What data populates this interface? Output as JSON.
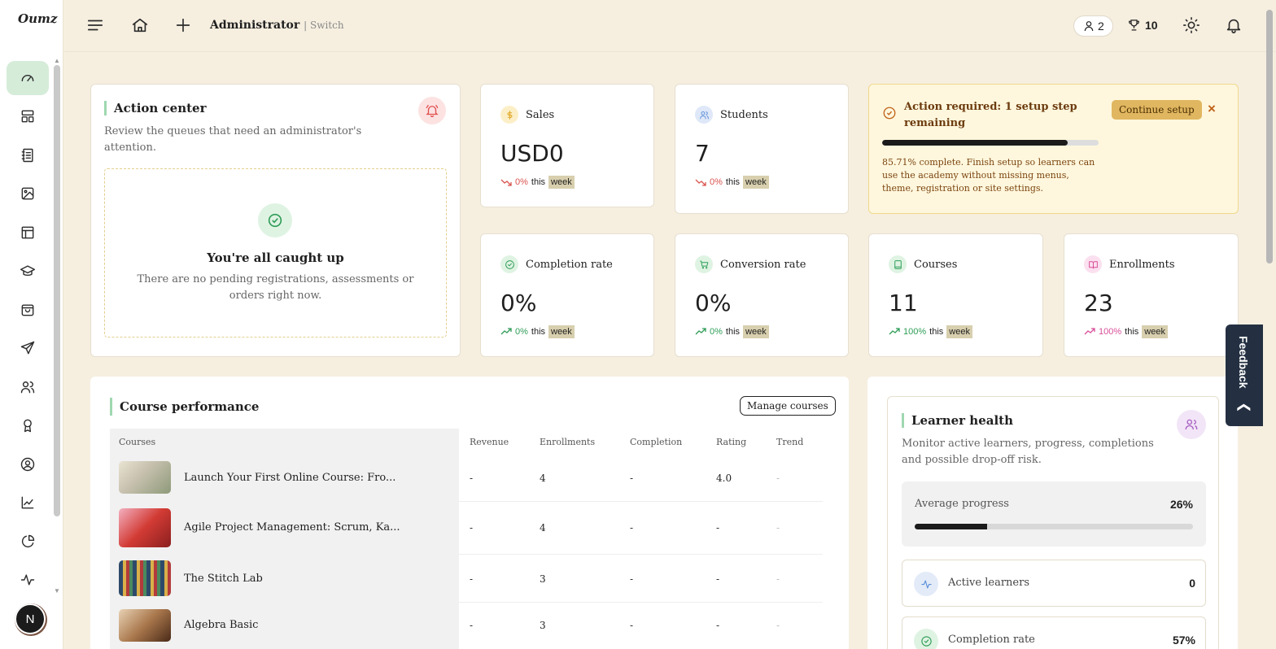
{
  "app": {
    "logo": "Oumz"
  },
  "topbar": {
    "title": "Administrator",
    "switch_label": "| Switch",
    "users_count": "2",
    "trophy_count": "10"
  },
  "sidebar": {
    "items": [
      {
        "icon": "dashboard-icon",
        "active": true
      },
      {
        "icon": "layout-icon"
      },
      {
        "icon": "notebook-icon"
      },
      {
        "icon": "image-icon"
      },
      {
        "icon": "template-icon"
      },
      {
        "icon": "graduation-cap-icon"
      },
      {
        "icon": "shopping-bag-icon"
      },
      {
        "icon": "send-icon"
      },
      {
        "icon": "users-icon"
      },
      {
        "icon": "award-icon"
      },
      {
        "icon": "user-circle-icon"
      },
      {
        "icon": "line-chart-icon"
      },
      {
        "icon": "pie-chart-icon"
      },
      {
        "icon": "activity-icon"
      }
    ],
    "avatar_letter": "N"
  },
  "action_center": {
    "title": "Action center",
    "description": "Review the queues that need an administrator's attention.",
    "empty_title": "You're all caught up",
    "empty_text": "There are no pending registrations, assessments or orders right now."
  },
  "stats": {
    "sales": {
      "label": "Sales",
      "value": "USD0",
      "trend": "0%",
      "this": "this",
      "week": "week",
      "direction": "down",
      "color": "#e0a31f"
    },
    "students": {
      "label": "Students",
      "value": "7",
      "trend": "0%",
      "this": "this",
      "week": "week",
      "direction": "down",
      "color": "#5b8fd8"
    },
    "completion": {
      "label": "Completion rate",
      "value": "0%",
      "trend": "0%",
      "this": "this",
      "week": "week",
      "direction": "up",
      "color": "#2f9d57"
    },
    "conversion": {
      "label": "Conversion rate",
      "value": "0%",
      "trend": "0%",
      "this": "this",
      "week": "week",
      "direction": "up",
      "color": "#2f9d57"
    },
    "courses": {
      "label": "Courses",
      "value": "11",
      "trend": "100%",
      "this": "this",
      "week": "week",
      "direction": "up",
      "color": "#2f9d57"
    },
    "enrollments": {
      "label": "Enrollments",
      "value": "23",
      "trend": "100%",
      "this": "this",
      "week": "week",
      "direction": "up",
      "color": "#d94f9a"
    }
  },
  "setup": {
    "title": "Action required: 1 setup step remaining",
    "button": "Continue setup",
    "close": "×",
    "progress": 0.8571,
    "text": "85.71% complete. Finish setup so learners can use the academy without missing menus, theme, registration or site settings."
  },
  "course_performance": {
    "title": "Course performance",
    "manage_button": "Manage courses",
    "columns": [
      "Courses",
      "Revenue",
      "Enrollments",
      "Completion",
      "Rating",
      "Trend"
    ],
    "rows": [
      {
        "name": "Launch Your First Online Course: Fro...",
        "revenue": "-",
        "enrollments": "4",
        "completion": "-",
        "rating": "4.0",
        "trend": "-",
        "thumb": "#c9c2b0"
      },
      {
        "name": "Agile Project Management: Scrum, Ka...",
        "revenue": "-",
        "enrollments": "4",
        "completion": "-",
        "rating": "-",
        "trend": "-",
        "thumb": "#d23b34"
      },
      {
        "name": "The Stitch Lab",
        "revenue": "-",
        "enrollments": "3",
        "completion": "-",
        "rating": "-",
        "trend": "-",
        "thumb": "#4b6f8e"
      },
      {
        "name": "Algebra Basic",
        "revenue": "-",
        "enrollments": "3",
        "completion": "-",
        "rating": "-",
        "trend": "-",
        "thumb": "#a9774c"
      }
    ]
  },
  "learner_health": {
    "title": "Learner health",
    "description": "Monitor active learners, progress, completions and possible drop-off risk.",
    "avg_label": "Average progress",
    "avg_value": "26%",
    "avg_fraction": 0.26,
    "metrics": [
      {
        "label": "Active learners",
        "value": "0",
        "icon": "activity-icon",
        "color": "#5b8fd8"
      },
      {
        "label": "Completion rate",
        "value": "57%",
        "icon": "check-circle-icon",
        "color": "#2f9d57"
      }
    ]
  },
  "feedback": {
    "label": "Feedback"
  }
}
